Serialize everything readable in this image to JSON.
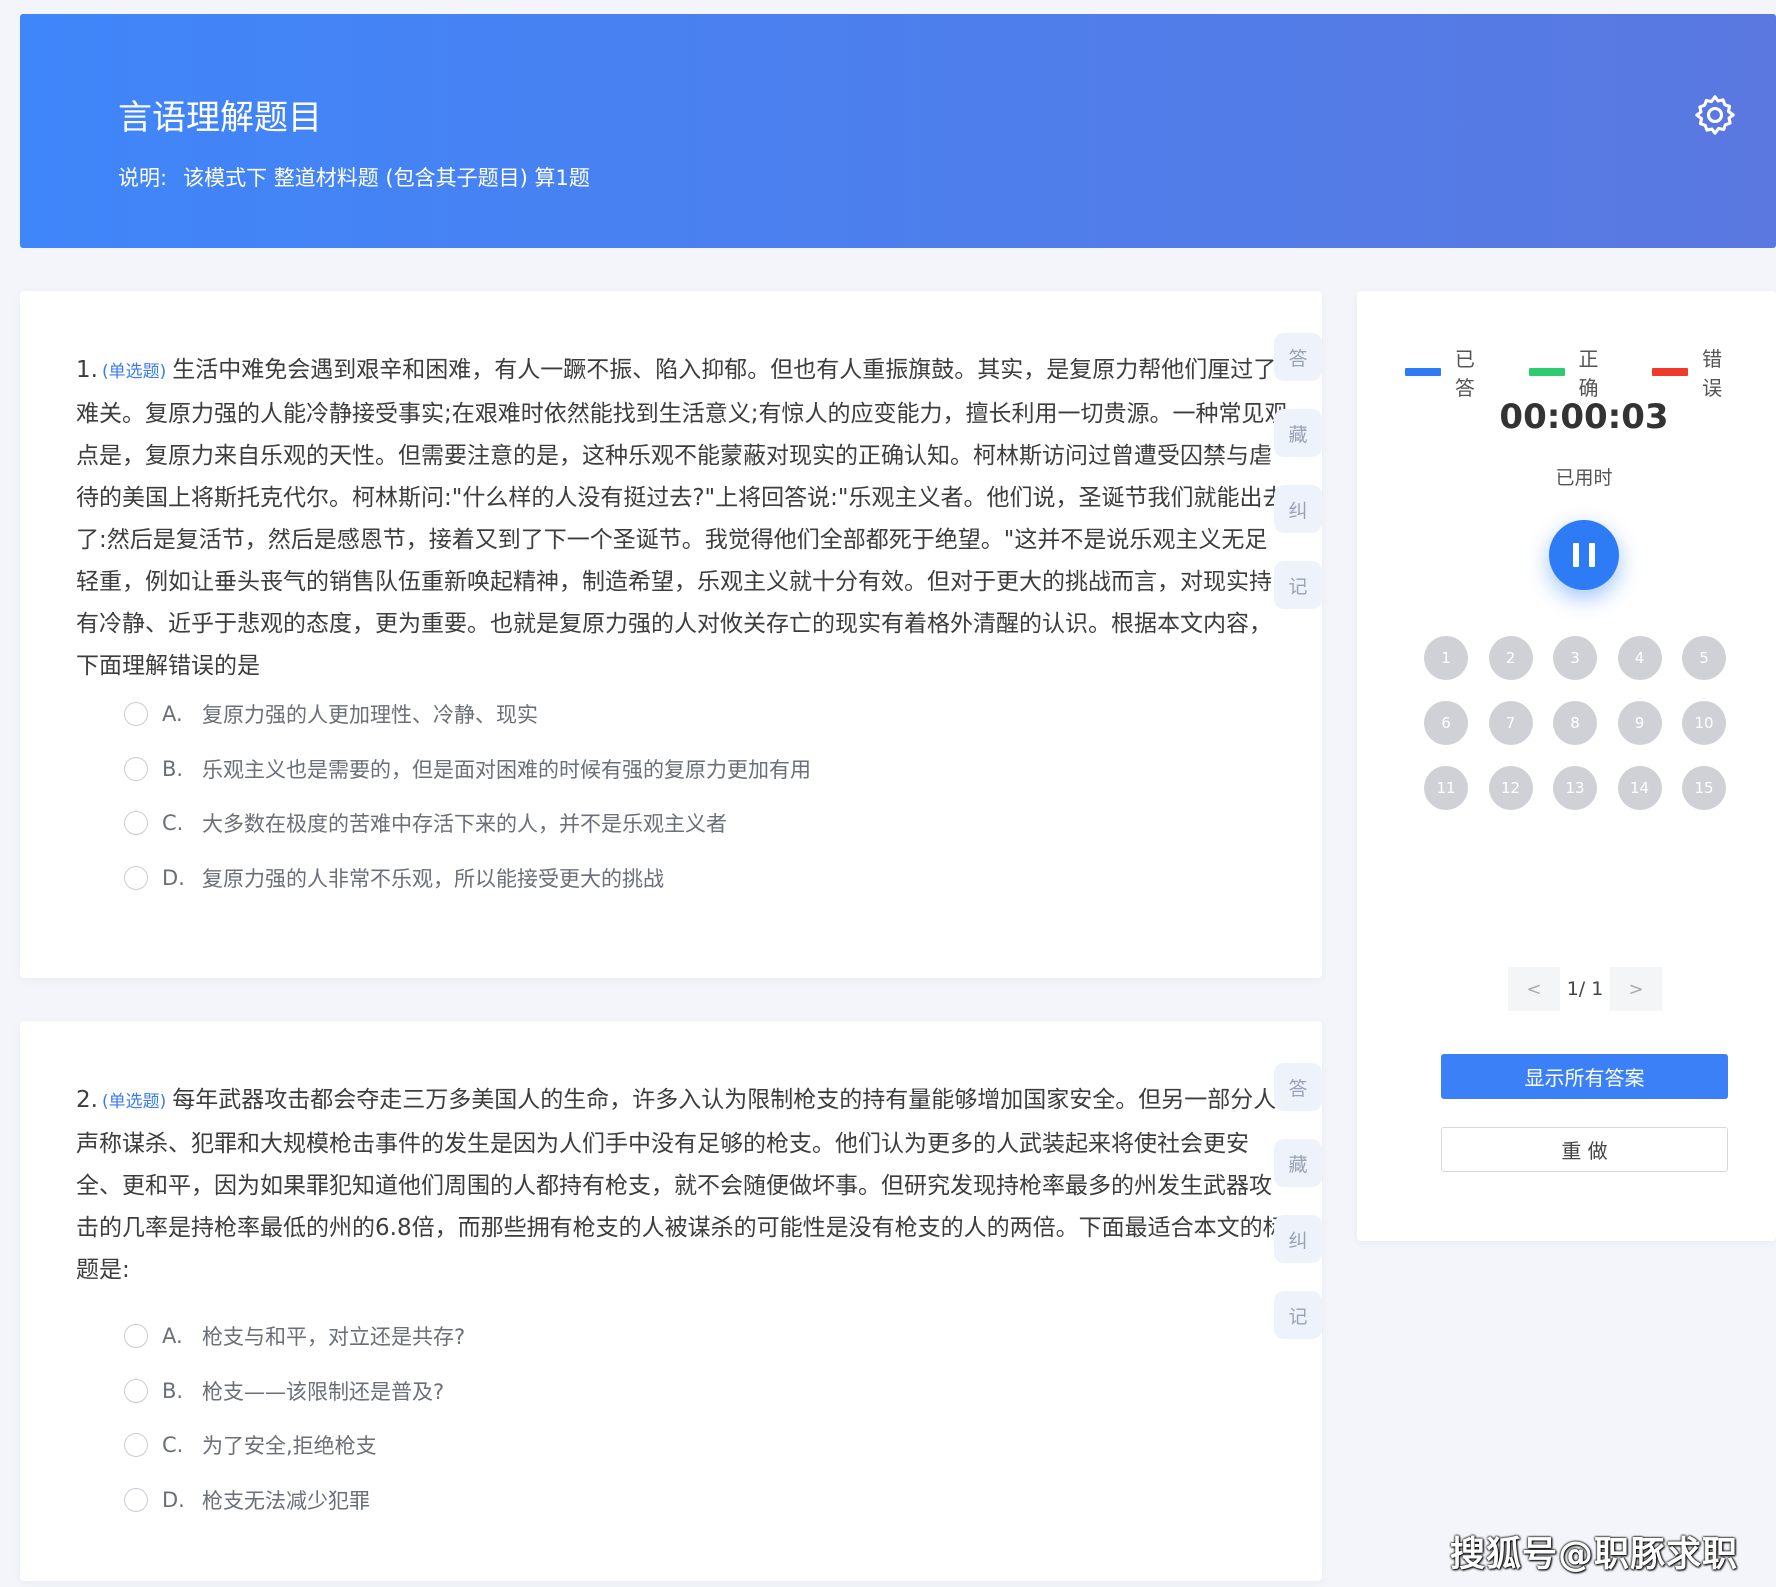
{
  "header": {
    "title": "言语理解题目",
    "desc_label": "说明:",
    "desc_text": "该模式下 整道材料题 (包含其子题目) 算1题",
    "settings_icon": "gear-icon"
  },
  "questions": [
    {
      "number": "1.",
      "type": "(单选题)",
      "text": "生活中难免会遇到艰辛和困难，有人一蹶不振、陷入抑郁。但也有人重振旗鼓。其实，是复原力帮他们厘过了难关。复原力强的人能冷静接受事实;在艰难时依然能找到生活意义;有惊人的应变能力，擅长利用一切贵源。一种常见观点是，复原力来自乐观的天性。但需要注意的是，这种乐观不能蒙蔽对现实的正确认知。柯林斯访问过曾遭受囚禁与虐待的美国上将斯托克代尔。柯林斯问:\"什么样的人没有挺过去?\"上将回答说:\"乐观主义者。他们说，圣诞节我们就能出去了:然后是复活节，然后是感恩节，接着又到了下一个圣诞节。我觉得他们全部都死于绝望。\"这并不是说乐观主义无足轻重，例如让垂头丧气的销售队伍重新唤起精神，制造希望，乐观主义就十分有效。但对于更大的挑战而言，对现实持有冷静、近乎于悲观的态度，更为重要。也就是复原力强的人对攸关存亡的现实有着格外清醒的认识。根据本文内容，下面理解错误的是",
      "options": [
        {
          "letter": "A.",
          "text": "复原力强的人更加理性、冷静、现实"
        },
        {
          "letter": "B.",
          "text": "乐观主义也是需要的，但是面对困难的时候有强的复原力更加有用"
        },
        {
          "letter": "C.",
          "text": "大多数在极度的苦难中存活下来的人，并不是乐观主义者"
        },
        {
          "letter": "D.",
          "text": "复原力强的人非常不乐观，所以能接受更大的挑战"
        }
      ]
    },
    {
      "number": "2.",
      "type": "(单选题)",
      "text": "每年武器攻击都会夺走三万多美国人的生命，许多入认为限制枪支的持有量能够增加国家安全。但另一部分人声称谋杀、犯罪和大规模枪击事件的发生是因为人们手中没有足够的枪支。他们认为更多的人武装起来将使社会更安全、更和平，因为如果罪犯知道他们周围的人都持有枪支，就不会随便做坏事。但研究发现持枪率最多的州发生武器攻击的几率是持枪率最低的州的6.8倍，而那些拥有枪支的人被谋杀的可能性是没有枪支的人的两倍。下面最适合本文的标题是:",
      "options": [
        {
          "letter": "A.",
          "text": "枪支与和平，对立还是共存?"
        },
        {
          "letter": "B.",
          "text": "枪支——该限制还是普及?"
        },
        {
          "letter": "C.",
          "text": "为了安全,拒绝枪支"
        },
        {
          "letter": "D.",
          "text": "枪支无法减少犯罪"
        }
      ]
    }
  ],
  "tools": [
    "答",
    "藏",
    "纠",
    "记"
  ],
  "sidebar": {
    "legend": [
      {
        "label": "已答",
        "color": "#2f7bf6"
      },
      {
        "label": "正确",
        "color": "#2ecc71"
      },
      {
        "label": "错误",
        "color": "#f0392b"
      }
    ],
    "timer": "00:00:03",
    "timer_label": "已用时",
    "pause_icon": "pause-icon",
    "numbers": [
      "1",
      "2",
      "3",
      "4",
      "5",
      "6",
      "7",
      "8",
      "9",
      "10",
      "11",
      "12",
      "13",
      "14",
      "15"
    ],
    "pager": {
      "prev": "<",
      "info": "1/ 1",
      "next": ">"
    },
    "show_answers": "显示所有答案",
    "redo": "重 做"
  },
  "watermark": "搜狐号@职豚求职",
  "colors": {
    "accent": "#3b80f7",
    "header_from": "#3f86fa",
    "header_to": "#5a78e0"
  }
}
